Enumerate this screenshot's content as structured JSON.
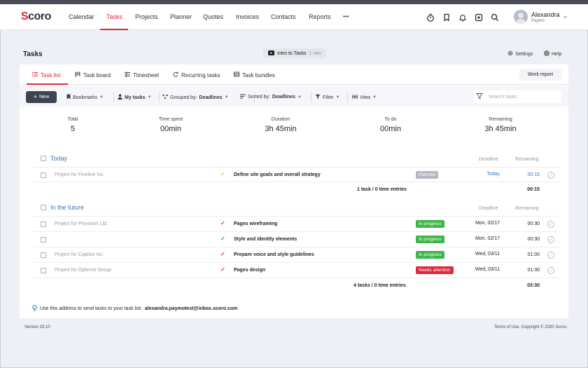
{
  "brand": {
    "logo_text": "Scoro",
    "accent_color": "#e0283c",
    "link_color": "#2f78c4"
  },
  "nav": {
    "items": [
      {
        "label": "Calendar"
      },
      {
        "label": "Tasks",
        "active": true
      },
      {
        "label": "Projects"
      },
      {
        "label": "Planner"
      },
      {
        "label": "Quotes"
      },
      {
        "label": "Invoices"
      },
      {
        "label": "Contacts"
      },
      {
        "label": "Reports"
      }
    ],
    "more_label": "•••",
    "icons": [
      "stopwatch-icon",
      "bookmark-icon",
      "bell-icon",
      "plus-square-icon",
      "search-icon"
    ],
    "user": {
      "name": "Alexandra",
      "sub": "Paymo"
    }
  },
  "page": {
    "title": "Tasks",
    "intro": {
      "label": "Intro to Tasks",
      "duration": "1 min"
    },
    "settings_label": "Settings",
    "help_label": "Help"
  },
  "tabs": [
    {
      "label": "Task list",
      "icon": "list-icon",
      "active": true
    },
    {
      "label": "Task board",
      "icon": "board-icon"
    },
    {
      "label": "Timesheet",
      "icon": "timesheet-icon"
    },
    {
      "label": "Recurring tasks",
      "icon": "recurring-icon"
    },
    {
      "label": "Task bundles",
      "icon": "bundle-icon"
    }
  ],
  "work_report_label": "Work report",
  "toolbar": {
    "new_label": "New",
    "bookmarks_label": "Bookmarks",
    "my_tasks_label": "My tasks",
    "grouped_prefix": "Grouped by:",
    "grouped_value": "Deadlines",
    "sorted_prefix": "Sorted by:",
    "sorted_value": "Deadlines",
    "filter_label": "Filter",
    "view_label": "View",
    "search_placeholder": "Search tasks"
  },
  "summary": [
    {
      "label": "Total",
      "value": "5"
    },
    {
      "label": "Time spent",
      "value": "00min"
    },
    {
      "label": "Duration",
      "value": "3h 45min"
    },
    {
      "label": "To do",
      "value": "00min"
    },
    {
      "label": "Remaining",
      "value": "3h 45min"
    }
  ],
  "groups": [
    {
      "title": "Today",
      "deadline_header": "Deadline",
      "remaining_header": "Remaining",
      "rows": [
        {
          "project": "Project for Fineline Inc.",
          "check_color": "#e8c33a",
          "title": "Define site goals and overall strategy",
          "status": "Planned",
          "status_color": "#b3b8c4",
          "deadline": "Today",
          "deadline_color": "#2f78c4",
          "remaining": "00:15",
          "remaining_color": "#2f78c4"
        }
      ],
      "totals_text": "1 task / 0 time entries",
      "totals_value": "00:15"
    },
    {
      "title": "In the future",
      "deadline_header": "Deadline",
      "remaining_header": "Remaining",
      "rows": [
        {
          "project": "Project for Provision Ltd.",
          "check_color": "#e0283c",
          "title": "Pages wireframing",
          "status": "In progress",
          "status_color": "#3db548",
          "deadline": "Mon, 02/17",
          "remaining": "00:30"
        },
        {
          "project": "",
          "check_color": "#2f78c4",
          "title": "Style and identity elements",
          "status": "In progress",
          "status_color": "#3db548",
          "deadline": "Mon, 02/17",
          "remaining": "00:30"
        },
        {
          "project": "Project for Captive Inc.",
          "check_color": "#e0283c",
          "title": "Prepare voice and style guidelines",
          "status": "In progress",
          "status_color": "#3db548",
          "deadline": "Wed, 03/11",
          "remaining": "01:00"
        },
        {
          "project": "Project for Optimist Group",
          "check_color": "#e0283c",
          "title": "Pages design",
          "status": "Needs attention",
          "status_color": "#e0283c",
          "deadline": "Wed, 03/11",
          "remaining": "01:30"
        }
      ],
      "totals_text": "4 tasks / 0 time entries",
      "totals_value": "03:30"
    }
  ],
  "footer": {
    "note": "Use this address to send tasks to your task list:",
    "email": "alexandra.paymotest@inbox.scoro.com",
    "version": "Version 19.10",
    "copyright": "Terms of Use. Copyright © 2020 Scoro."
  }
}
